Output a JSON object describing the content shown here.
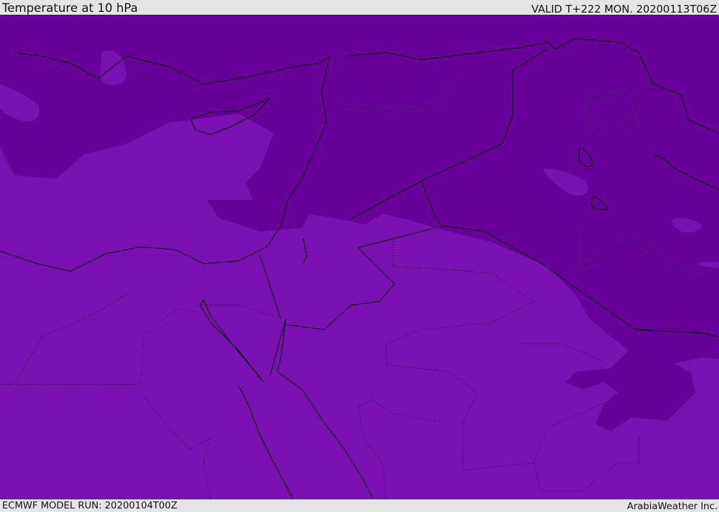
{
  "header": {
    "title": "Temperature at 10 hPa",
    "valid": "VALID T+222 MON. 20200113T06Z"
  },
  "footer": {
    "model_run": "ECMWF MODEL RUN: 20200104T00Z",
    "credit": "ArabiaWeather Inc."
  },
  "colors": {
    "cold": "#660099",
    "mild": "#7a12b3",
    "background": "#e5e5e5"
  }
}
